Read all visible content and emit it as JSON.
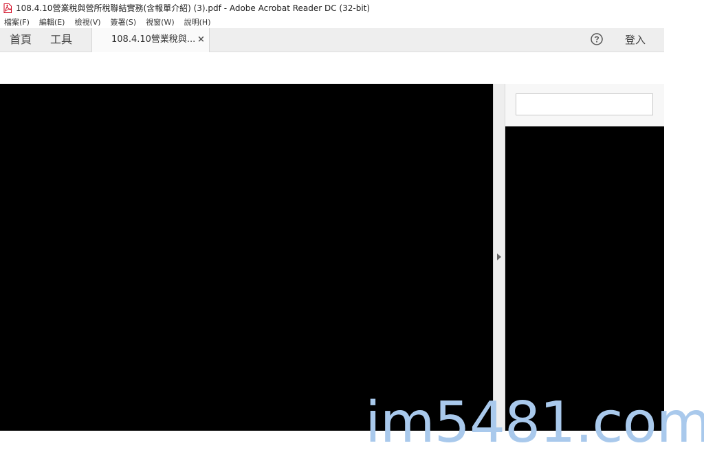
{
  "window": {
    "title": "108.4.10營業稅與營所稅聯結實務(含報單介紹) (3).pdf - Adobe Acrobat Reader DC (32-bit)",
    "icon": "pdf-icon",
    "accent": "#d0021b"
  },
  "menu": {
    "items": [
      "檔案(F)",
      "編輯(E)",
      "檢視(V)",
      "簽署(S)",
      "視窗(W)",
      "說明(H)"
    ]
  },
  "nav": {
    "home": "首頁",
    "tools": "工具",
    "tab_label": "108.4.10營業稅與...",
    "tab_close": "×",
    "help_icon": "help-circle-icon",
    "signin": "登入"
  },
  "side_panel": {
    "search_value": "",
    "collapse_icon": "chevron-right-icon"
  },
  "watermark": {
    "text": "im5481.com",
    "color": "#a9c9ec"
  }
}
